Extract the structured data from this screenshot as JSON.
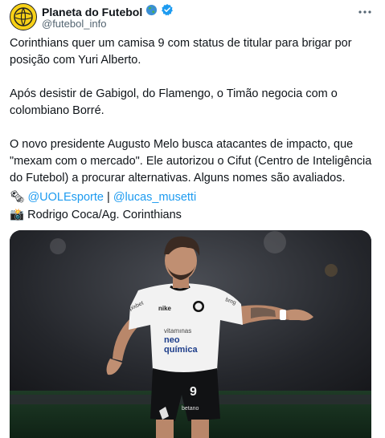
{
  "author": {
    "name": "Planeta do Futebol",
    "handle": "@futebol_info",
    "globe_icon": "globe-icon",
    "verified_icon": "verified-badge-icon"
  },
  "tweet": {
    "paragraphs": [
      "Corinthians quer um camisa 9 com status de titular para brigar por posição com Yuri Alberto.",
      "Após desistir de Gabigol, do Flamengo, o Timão negocia com o colombiano Borré.",
      "O novo presidente Augusto Melo busca atacantes de impacto, que \"mexam com o mercado\". Ele autorizou o Cifut (Centro de Inteligência do Futebol) a procurar alternativas. Alguns nomes são avaliados."
    ],
    "credit_line_1": {
      "emoji": "🗞",
      "mention_1": "@UOLEsporte",
      "separator": "|",
      "mention_2": "@lucas_musetti"
    },
    "credit_line_2": {
      "emoji": "📸",
      "text": "Rodrigo Coca/Ag. Corinthians"
    }
  },
  "media": {
    "jersey_number": "9",
    "sponsor_line_1": "vitamınas",
    "sponsor_line_2": "neo",
    "sponsor_line_3": "química",
    "shorts_sponsor": "betano"
  },
  "colors": {
    "accent": "#1d9bf0",
    "text": "#0f1419",
    "muted": "#536471",
    "background": "#ffffff"
  }
}
